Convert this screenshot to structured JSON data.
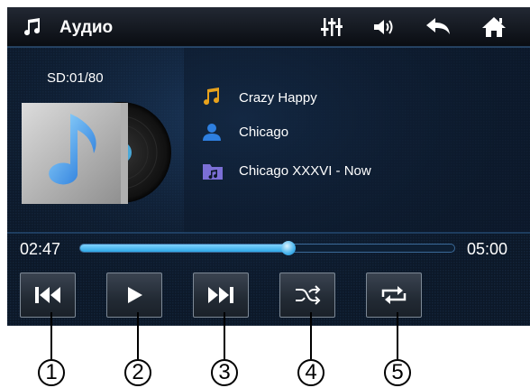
{
  "header": {
    "title": "Аудио",
    "icons": [
      "music-note-icon",
      "equalizer-icon",
      "volume-icon",
      "back-icon",
      "home-icon"
    ]
  },
  "album": {
    "track_counter": "SD:01/80"
  },
  "track": {
    "title": "Crazy Happy",
    "artist": "Chicago",
    "album": "Chicago XXXVI - Now"
  },
  "progress": {
    "elapsed": "02:47",
    "total": "05:00",
    "fraction": 0.5567
  },
  "controls": [
    "previous-button",
    "play-button",
    "next-button",
    "shuffle-button",
    "repeat-button"
  ],
  "callouts": [
    "1",
    "2",
    "3",
    "4",
    "5"
  ],
  "colors": {
    "accent": "#2fa8e6",
    "note": "#e8a21c",
    "artist": "#2e7fe0",
    "folder": "#7b6fd6"
  }
}
